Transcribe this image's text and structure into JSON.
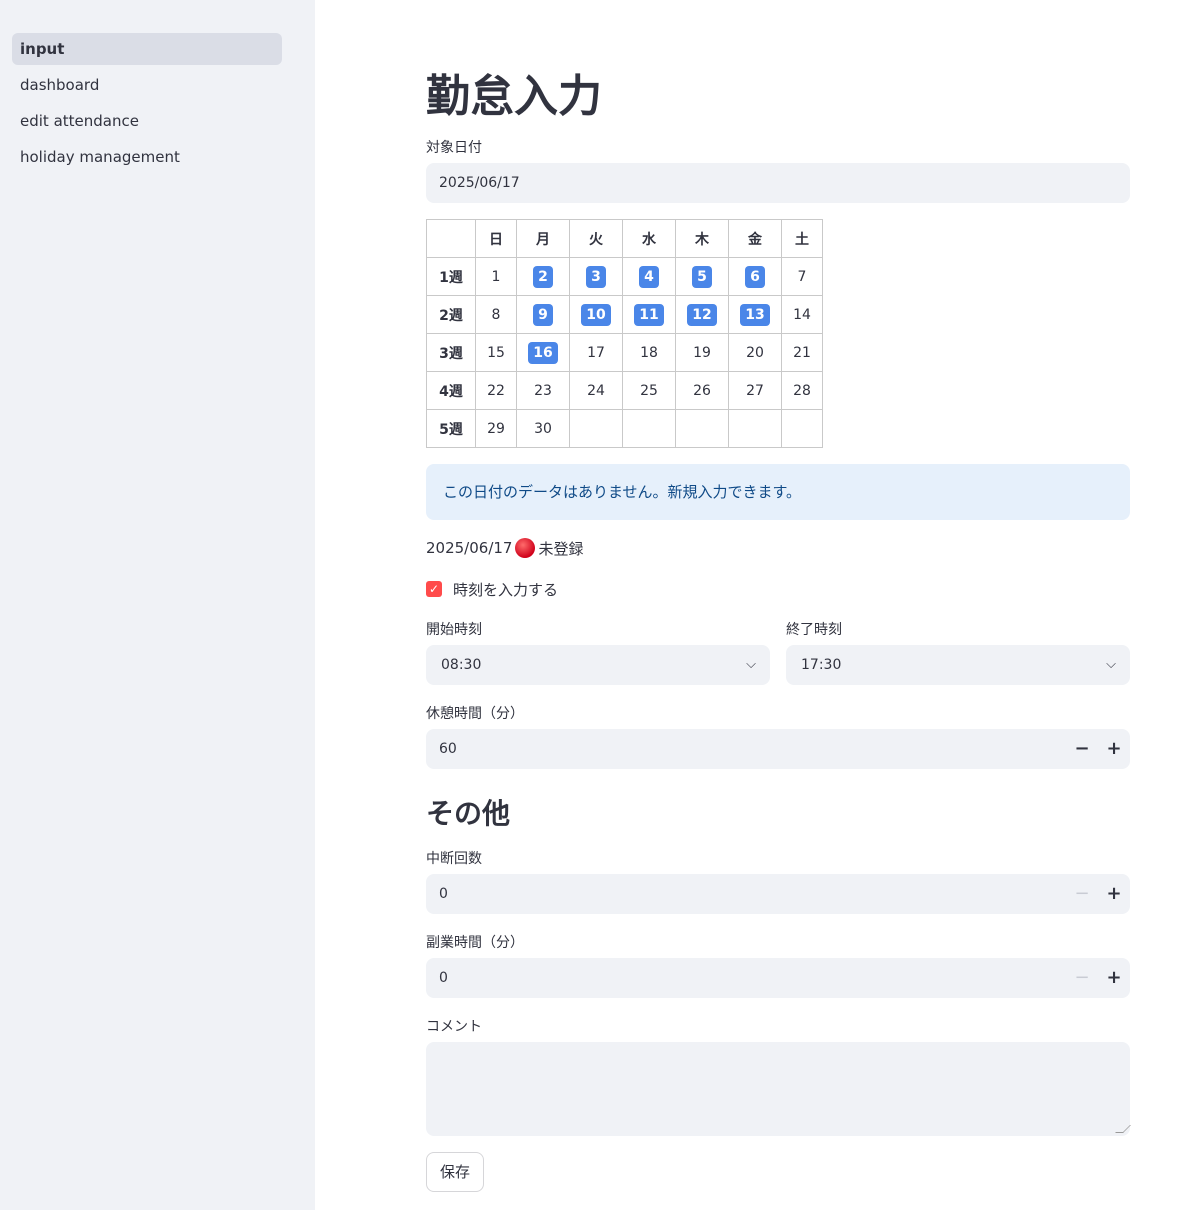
{
  "sidebar": {
    "items": [
      {
        "label": "input"
      },
      {
        "label": "dashboard"
      },
      {
        "label": "edit attendance"
      },
      {
        "label": "holiday management"
      }
    ]
  },
  "page": {
    "title": "勤怠入力",
    "date_label": "対象日付",
    "date_value": "2025/06/17"
  },
  "calendar": {
    "headers": [
      "",
      "日",
      "月",
      "火",
      "水",
      "木",
      "金",
      "土"
    ],
    "rows": [
      {
        "week": "1週",
        "days": [
          "1",
          "2",
          "3",
          "4",
          "5",
          "6",
          "7"
        ]
      },
      {
        "week": "2週",
        "days": [
          "8",
          "9",
          "10",
          "11",
          "12",
          "13",
          "14"
        ]
      },
      {
        "week": "3週",
        "days": [
          "15",
          "16",
          "17",
          "18",
          "19",
          "20",
          "21"
        ]
      },
      {
        "week": "4週",
        "days": [
          "22",
          "23",
          "24",
          "25",
          "26",
          "27",
          "28"
        ]
      },
      {
        "week": "5週",
        "days": [
          "29",
          "30",
          "",
          "",
          "",
          "",
          ""
        ]
      }
    ],
    "highlighted_days": [
      "2",
      "3",
      "4",
      "5",
      "6",
      "9",
      "10",
      "11",
      "12",
      "13",
      "16"
    ],
    "highlight_color": "#4a86e8"
  },
  "info": {
    "message": "この日付のデータはありません。新規入力できます。"
  },
  "status": {
    "date": "2025/06/17",
    "text": "未登録",
    "icon": "red-circle-icon"
  },
  "time_input": {
    "checkbox_label": "時刻を入力する",
    "checked": true,
    "start_label": "開始時刻",
    "start_value": "08:30",
    "end_label": "終了時刻",
    "end_value": "17:30",
    "break_label": "休憩時間（分）",
    "break_value": "60"
  },
  "other": {
    "heading": "その他",
    "interruptions_label": "中断回数",
    "interruptions_value": "0",
    "side_job_label": "副業時間（分）",
    "side_job_value": "0",
    "comment_label": "コメント",
    "comment_value": ""
  },
  "actions": {
    "save_label": "保存"
  },
  "colors": {
    "accent": "#ff4b4b",
    "sidebar_bg": "#f0f2f6",
    "info_bg": "#e6f0fb",
    "info_text": "#0f4a87"
  }
}
